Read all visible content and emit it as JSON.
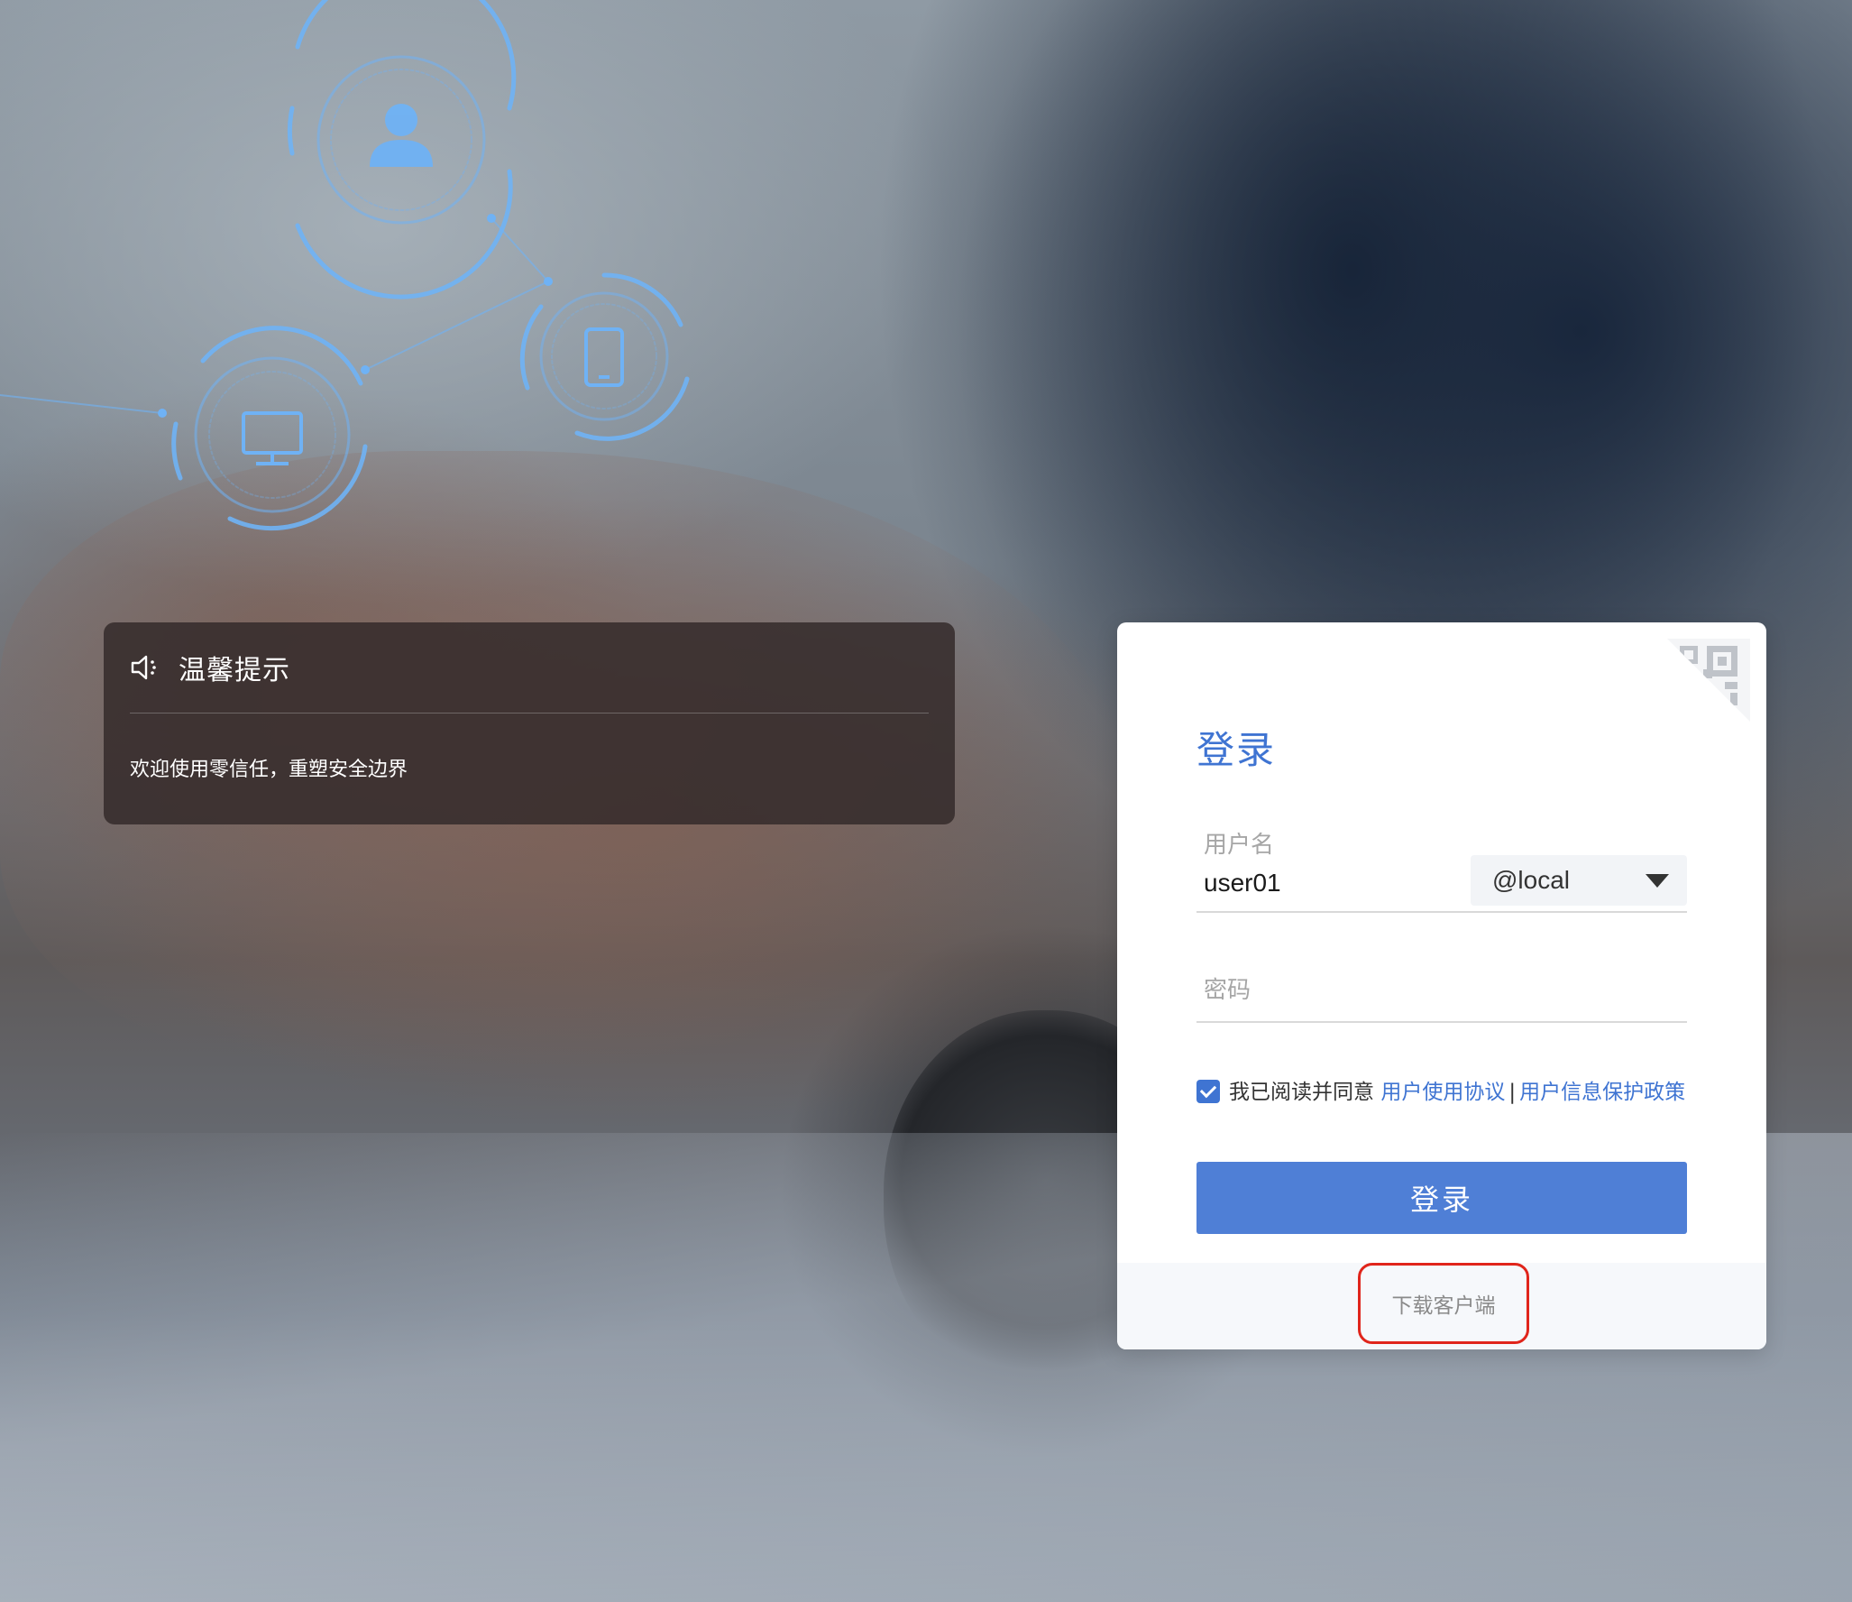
{
  "background": {
    "illustration_icons": [
      "user-icon",
      "mobile-phone-icon",
      "monitor-icon"
    ],
    "accent": "#5ea6f2"
  },
  "tips": {
    "icon": "speaker-icon",
    "title": "温馨提示",
    "message": "欢迎使用零信任，重塑安全边界"
  },
  "login": {
    "qr_icon": "qr-code-icon",
    "title": "登录",
    "username_label": "用户名",
    "username_value": "user01",
    "domain_value": "@local",
    "password_placeholder": "密码",
    "agree_checked": true,
    "agree_text": "我已阅读并同意",
    "agree_link_terms": "用户使用协议",
    "agree_separator": "|",
    "agree_link_privacy": "用户信息保护政策",
    "submit_label": "登录",
    "download_label": "下载客户端"
  },
  "colors": {
    "primary": "#3f74d2",
    "button": "#4f7fd6",
    "highlight_border": "#e0251b"
  }
}
